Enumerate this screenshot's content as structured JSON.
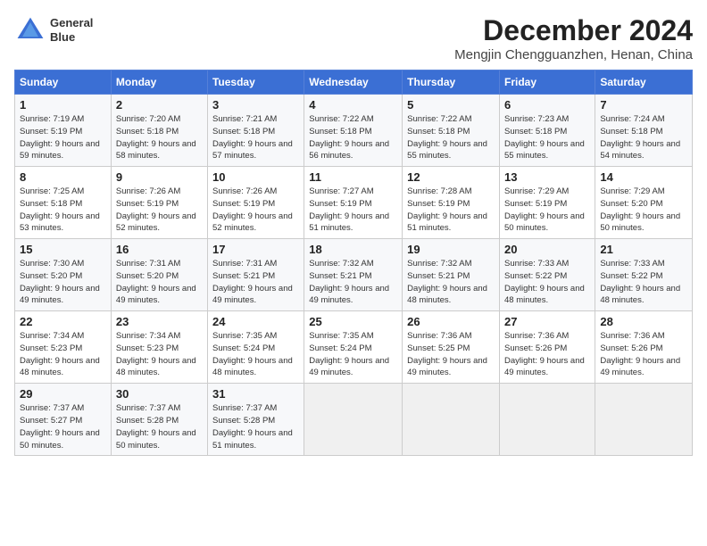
{
  "header": {
    "logo_line1": "General",
    "logo_line2": "Blue",
    "month": "December 2024",
    "location": "Mengjin Chengguanzhen, Henan, China"
  },
  "weekdays": [
    "Sunday",
    "Monday",
    "Tuesday",
    "Wednesday",
    "Thursday",
    "Friday",
    "Saturday"
  ],
  "weeks": [
    [
      {
        "day": "1",
        "sunrise": "7:19 AM",
        "sunset": "5:19 PM",
        "daylight": "9 hours and 59 minutes."
      },
      {
        "day": "2",
        "sunrise": "7:20 AM",
        "sunset": "5:18 PM",
        "daylight": "9 hours and 58 minutes."
      },
      {
        "day": "3",
        "sunrise": "7:21 AM",
        "sunset": "5:18 PM",
        "daylight": "9 hours and 57 minutes."
      },
      {
        "day": "4",
        "sunrise": "7:22 AM",
        "sunset": "5:18 PM",
        "daylight": "9 hours and 56 minutes."
      },
      {
        "day": "5",
        "sunrise": "7:22 AM",
        "sunset": "5:18 PM",
        "daylight": "9 hours and 55 minutes."
      },
      {
        "day": "6",
        "sunrise": "7:23 AM",
        "sunset": "5:18 PM",
        "daylight": "9 hours and 55 minutes."
      },
      {
        "day": "7",
        "sunrise": "7:24 AM",
        "sunset": "5:18 PM",
        "daylight": "9 hours and 54 minutes."
      }
    ],
    [
      {
        "day": "8",
        "sunrise": "7:25 AM",
        "sunset": "5:18 PM",
        "daylight": "9 hours and 53 minutes."
      },
      {
        "day": "9",
        "sunrise": "7:26 AM",
        "sunset": "5:19 PM",
        "daylight": "9 hours and 52 minutes."
      },
      {
        "day": "10",
        "sunrise": "7:26 AM",
        "sunset": "5:19 PM",
        "daylight": "9 hours and 52 minutes."
      },
      {
        "day": "11",
        "sunrise": "7:27 AM",
        "sunset": "5:19 PM",
        "daylight": "9 hours and 51 minutes."
      },
      {
        "day": "12",
        "sunrise": "7:28 AM",
        "sunset": "5:19 PM",
        "daylight": "9 hours and 51 minutes."
      },
      {
        "day": "13",
        "sunrise": "7:29 AM",
        "sunset": "5:19 PM",
        "daylight": "9 hours and 50 minutes."
      },
      {
        "day": "14",
        "sunrise": "7:29 AM",
        "sunset": "5:20 PM",
        "daylight": "9 hours and 50 minutes."
      }
    ],
    [
      {
        "day": "15",
        "sunrise": "7:30 AM",
        "sunset": "5:20 PM",
        "daylight": "9 hours and 49 minutes."
      },
      {
        "day": "16",
        "sunrise": "7:31 AM",
        "sunset": "5:20 PM",
        "daylight": "9 hours and 49 minutes."
      },
      {
        "day": "17",
        "sunrise": "7:31 AM",
        "sunset": "5:21 PM",
        "daylight": "9 hours and 49 minutes."
      },
      {
        "day": "18",
        "sunrise": "7:32 AM",
        "sunset": "5:21 PM",
        "daylight": "9 hours and 49 minutes."
      },
      {
        "day": "19",
        "sunrise": "7:32 AM",
        "sunset": "5:21 PM",
        "daylight": "9 hours and 48 minutes."
      },
      {
        "day": "20",
        "sunrise": "7:33 AM",
        "sunset": "5:22 PM",
        "daylight": "9 hours and 48 minutes."
      },
      {
        "day": "21",
        "sunrise": "7:33 AM",
        "sunset": "5:22 PM",
        "daylight": "9 hours and 48 minutes."
      }
    ],
    [
      {
        "day": "22",
        "sunrise": "7:34 AM",
        "sunset": "5:23 PM",
        "daylight": "9 hours and 48 minutes."
      },
      {
        "day": "23",
        "sunrise": "7:34 AM",
        "sunset": "5:23 PM",
        "daylight": "9 hours and 48 minutes."
      },
      {
        "day": "24",
        "sunrise": "7:35 AM",
        "sunset": "5:24 PM",
        "daylight": "9 hours and 48 minutes."
      },
      {
        "day": "25",
        "sunrise": "7:35 AM",
        "sunset": "5:24 PM",
        "daylight": "9 hours and 49 minutes."
      },
      {
        "day": "26",
        "sunrise": "7:36 AM",
        "sunset": "5:25 PM",
        "daylight": "9 hours and 49 minutes."
      },
      {
        "day": "27",
        "sunrise": "7:36 AM",
        "sunset": "5:26 PM",
        "daylight": "9 hours and 49 minutes."
      },
      {
        "day": "28",
        "sunrise": "7:36 AM",
        "sunset": "5:26 PM",
        "daylight": "9 hours and 49 minutes."
      }
    ],
    [
      {
        "day": "29",
        "sunrise": "7:37 AM",
        "sunset": "5:27 PM",
        "daylight": "9 hours and 50 minutes."
      },
      {
        "day": "30",
        "sunrise": "7:37 AM",
        "sunset": "5:28 PM",
        "daylight": "9 hours and 50 minutes."
      },
      {
        "day": "31",
        "sunrise": "7:37 AM",
        "sunset": "5:28 PM",
        "daylight": "9 hours and 51 minutes."
      },
      null,
      null,
      null,
      null
    ]
  ]
}
